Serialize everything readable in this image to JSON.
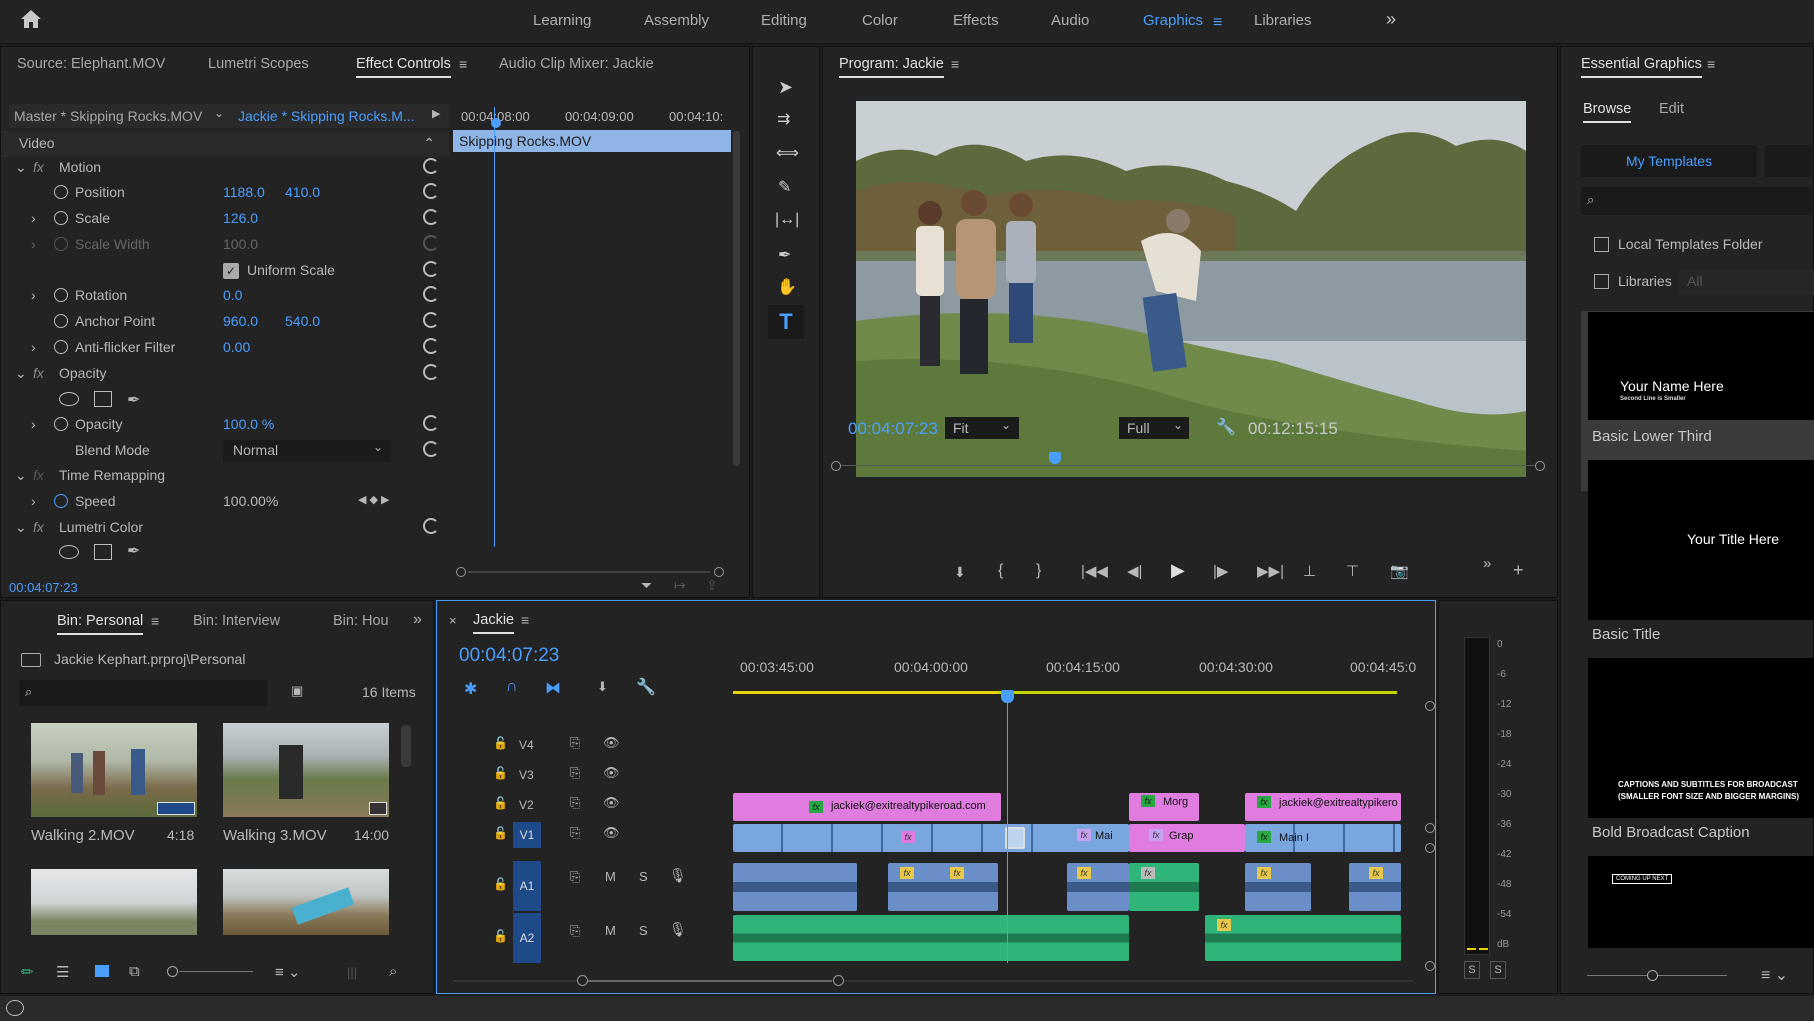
{
  "workspaces": {
    "tabs": [
      "Learning",
      "Assembly",
      "Editing",
      "Color",
      "Effects",
      "Audio",
      "Graphics",
      "Libraries"
    ],
    "active": "Graphics"
  },
  "source_panel": {
    "tabs": [
      "Source: Elephant.MOV",
      "Lumetri Scopes",
      "Effect Controls",
      "Audio Clip Mixer: Jackie"
    ],
    "active_tab": "Effect Controls",
    "master_label": "Master * Skipping Rocks.MOV",
    "sequence_label": "Jackie * Skipping Rocks.M...",
    "ruler_times": [
      "00:04:08:00",
      "00:04:09:00",
      "00:04:10:"
    ],
    "clip_name": "Skipping Rocks.MOV",
    "section_video": "Video",
    "motion": "Motion",
    "position_label": "Position",
    "position_x": "1188.0",
    "position_y": "410.0",
    "scale_label": "Scale",
    "scale_value": "126.0",
    "scale_width_label": "Scale Width",
    "scale_width_value": "100.0",
    "uniform_scale_label": "Uniform Scale",
    "rotation_label": "Rotation",
    "rotation_value": "0.0",
    "anchor_label": "Anchor Point",
    "anchor_x": "960.0",
    "anchor_y": "540.0",
    "antiflicker_label": "Anti-flicker Filter",
    "antiflicker_value": "0.00",
    "opacity_section": "Opacity",
    "opacity_label": "Opacity",
    "opacity_value": "100.0 %",
    "blend_label": "Blend Mode",
    "blend_value": "Normal",
    "time_remap": "Time Remapping",
    "speed_label": "Speed",
    "speed_value": "100.00%",
    "lumetri": "Lumetri Color",
    "timecode": "00:04:07:23"
  },
  "program_monitor": {
    "title": "Program: Jackie",
    "timecode": "00:04:07:23",
    "fit": "Fit",
    "quality": "Full",
    "duration": "00:12:15:15"
  },
  "essential_graphics": {
    "title": "Essential Graphics",
    "tabs": [
      "Browse",
      "Edit"
    ],
    "active_tab": "Browse",
    "my_templates": "My Templates",
    "local_templates": "Local Templates Folder",
    "libraries": "Libraries",
    "libraries_select": "All",
    "templates": [
      {
        "name": "Basic Lower Third",
        "preview_line1": "Your Name Here",
        "preview_line2": "Second Line is Smaller"
      },
      {
        "name": "Basic Title",
        "preview_line1": "Your Title Here"
      },
      {
        "name": "Bold Broadcast Caption",
        "preview_line1": "CAPTIONS AND SUBTITLES FOR BROADCAST",
        "preview_line2": "(SMALLER FONT SIZE AND BIGGER MARGINS)"
      },
      {
        "name": "",
        "preview_line1": "COMING UP NEXT"
      }
    ]
  },
  "bin_panel": {
    "tabs": [
      "Bin: Personal",
      "Bin: Interview",
      "Bin: Hou"
    ],
    "active_tab": "Bin: Personal",
    "path": "Jackie Kephart.prproj\\Personal",
    "items_count": "16 Items",
    "clips": [
      {
        "name": "Walking 2.MOV",
        "duration": "4:18"
      },
      {
        "name": "Walking 3.MOV",
        "duration": "14:00"
      }
    ]
  },
  "timeline": {
    "sequence": "Jackie",
    "timecode": "00:04:07:23",
    "ruler": [
      "00:03:45:00",
      "00:04:00:00",
      "00:04:15:00",
      "00:04:30:00",
      "00:04:45:0"
    ],
    "tracks": [
      {
        "name": "V4"
      },
      {
        "name": "V3"
      },
      {
        "name": "V2"
      },
      {
        "name": "V1"
      },
      {
        "name": "A1"
      },
      {
        "name": "A2"
      }
    ],
    "clip_labels": {
      "v2_a": "jackiek@exitrealtypikeroad.com",
      "v2_b": "Morg",
      "v2_c": "jackiek@exitrealtypikero",
      "v1_a": "Mai",
      "v1_b": "Grap",
      "v1_c": "Main I"
    },
    "track_buttons": {
      "mute": "M",
      "solo": "S"
    }
  },
  "meter": {
    "scale": [
      "0",
      "-6",
      "-12",
      "-18",
      "-24",
      "-30",
      "-36",
      "-42",
      "-48",
      "-54",
      "dB"
    ],
    "solo_buttons": [
      "S",
      "S"
    ]
  },
  "colors": {
    "accent": "#4a9eff",
    "graphics_clip": "#e07be0",
    "video_clip": "#7aa6e0",
    "audio_clip": "#2fb57a",
    "work_area": "#e8d200"
  }
}
